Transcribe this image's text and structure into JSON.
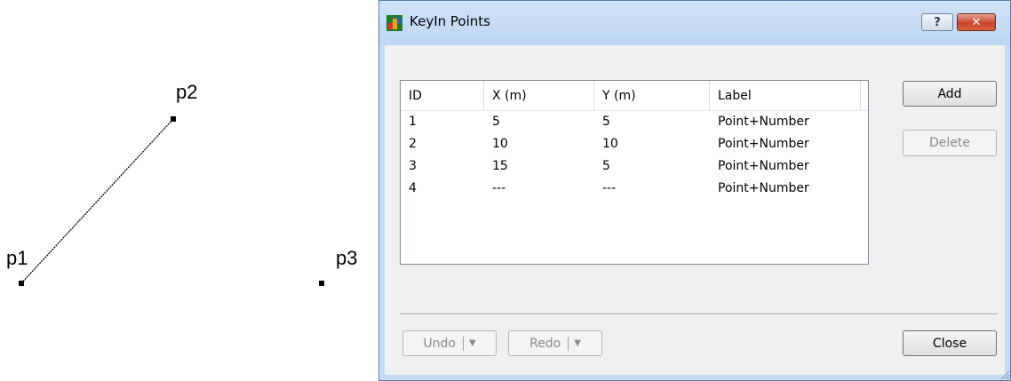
{
  "canvas": {
    "points": [
      {
        "label": "p1"
      },
      {
        "label": "p2"
      },
      {
        "label": "p3"
      }
    ]
  },
  "dialog": {
    "title": "KeyIn Points",
    "help_label": "?",
    "close_x_label": "✕",
    "table": {
      "columns": [
        "ID",
        "X (m)",
        "Y (m)",
        "Label"
      ],
      "rows": [
        {
          "id": "1",
          "x": "5",
          "y": "5",
          "label": "Point+Number"
        },
        {
          "id": "2",
          "x": "10",
          "y": "10",
          "label": "Point+Number"
        },
        {
          "id": "3",
          "x": "15",
          "y": "5",
          "label": "Point+Number"
        },
        {
          "id": "4",
          "x": "---",
          "y": "---",
          "label": "Point+Number"
        }
      ]
    },
    "buttons": {
      "add": "Add",
      "delete": "Delete",
      "undo": "Undo",
      "redo": "Redo",
      "close": "Close"
    },
    "colors": {
      "frame": "#c5dcf2",
      "client": "#f0f0f0",
      "close_x": "#c8442b"
    }
  }
}
